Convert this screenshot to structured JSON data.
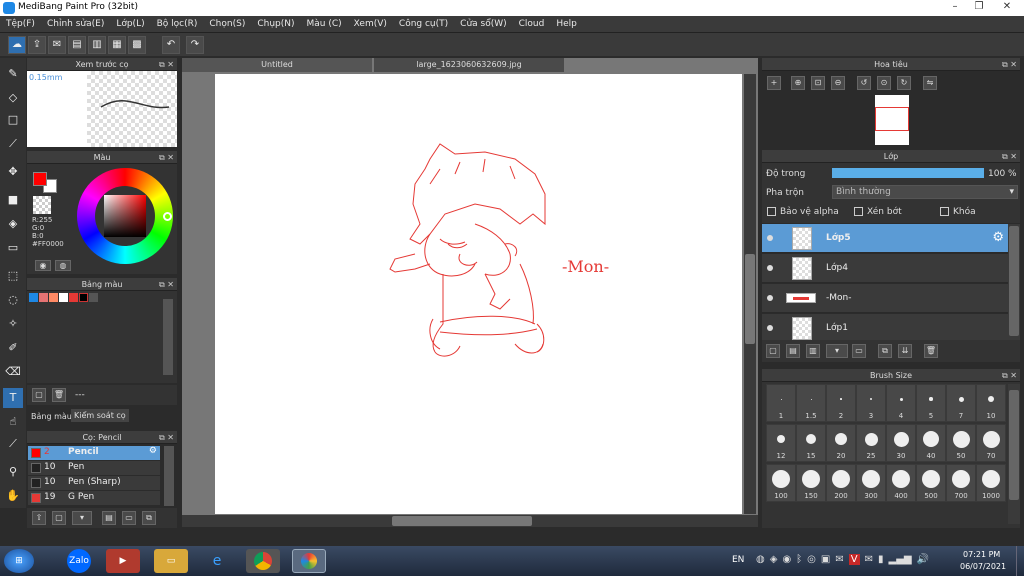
{
  "title": "MediBang Paint Pro (32bit)",
  "menu": [
    "Tệp(F)",
    "Chỉnh sửa(E)",
    "Lớp(L)",
    "Bộ lọc(R)",
    "Chọn(S)",
    "Chụp(N)",
    "Màu (C)",
    "Xem(V)",
    "Công cụ(T)",
    "Cửa sổ(W)",
    "Cloud",
    "Help"
  ],
  "tabs": [
    "Untitled",
    "large_1623060632609.jpg"
  ],
  "brush_preview": {
    "title": "Xem trước cọ",
    "size": "0.15mm"
  },
  "color": {
    "title": "Màu",
    "r": "R:255",
    "g": "G:0",
    "b": "B:0",
    "hex": "#FF0000",
    "fg": "#ff0000",
    "bg": "#ffffff"
  },
  "palette": {
    "title": "Bảng màu",
    "colors": [
      "#1e88e5",
      "#e57373",
      "#ff8a65",
      "#ffffff",
      "#e53935",
      "#000000"
    ],
    "more": "---",
    "tab1": "Bảng màu",
    "tab2": "Kiểm soát cọ"
  },
  "brush_list": {
    "title": "Cọ: Pencil",
    "items": [
      {
        "num": "2",
        "name": "Pencil",
        "color": "#ff0000"
      },
      {
        "num": "10",
        "name": "Pen",
        "color": "#222222"
      },
      {
        "num": "10",
        "name": "Pen (Sharp)",
        "color": "#222222"
      },
      {
        "num": "19",
        "name": "G Pen",
        "color": "#e53935"
      }
    ]
  },
  "navigator": {
    "title": "Hoa tiêu"
  },
  "layer": {
    "title": "Lớp",
    "opacity_label": "Độ trong",
    "opacity_value": "100 %",
    "opacity": 1.0,
    "blend_label": "Pha trộn",
    "blend_value": "Bình thường",
    "protect_alpha": "Bảo vệ alpha",
    "clip": "Xén bớt",
    "lock": "Khóa",
    "items": [
      "Lớp5",
      "Lớp4",
      "-Mon-",
      "Lớp1"
    ]
  },
  "brush_size": {
    "title": "Brush Size",
    "sizes": [
      "1",
      "1.5",
      "2",
      "3",
      "4",
      "5",
      "7",
      "10",
      "12",
      "15",
      "20",
      "25",
      "30",
      "40",
      "50",
      "70",
      "100",
      "150",
      "200",
      "300",
      "400",
      "500",
      "700",
      "1000"
    ]
  },
  "canvas_text": "-Mon-",
  "taskbar": {
    "lang": "EN",
    "time": "07:21 PM",
    "date": "06/07/2021",
    "zalo": "Zalo"
  }
}
